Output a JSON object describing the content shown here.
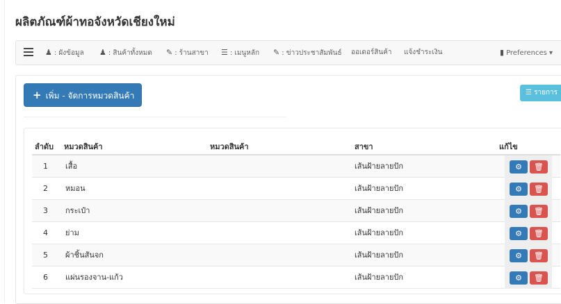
{
  "page": {
    "title": "ผลิตภัณฑ์ผ้าทอจังหวัดเชียงใหม่"
  },
  "nav": {
    "items": [
      {
        "icon": "user-icon",
        "glyph": "♟",
        "label": ": ผังข้อมูล"
      },
      {
        "icon": "user-icon",
        "glyph": "♟",
        "label": ": สินค้าทั้งหมด"
      },
      {
        "icon": "leaf-icon",
        "glyph": "✎",
        "label": ": ร้านสาขา"
      },
      {
        "icon": "list-icon",
        "glyph": "☰",
        "label": ": เมนูหลัก"
      },
      {
        "icon": "leaf-icon",
        "glyph": "✎",
        "label": ": ข่าวประชาสัมพันธ์"
      },
      {
        "icon": "",
        "glyph": "",
        "label": "ออเดอร์สินค้า"
      },
      {
        "icon": "",
        "glyph": "",
        "label": "แจ้งชำระเงิน"
      }
    ],
    "preferences": {
      "glyph": "▮",
      "label": "Preferences ▾"
    }
  },
  "actions": {
    "add_label": "เพิ่ม - จัดการหมวดสินค้า",
    "list_label": "☰ รายการ"
  },
  "table": {
    "headers": [
      "ลำดับ",
      "หมวดสินค้า",
      "หมวดสินค้า",
      "สาขา",
      "แก้ไข"
    ],
    "rows": [
      {
        "no": "1",
        "category": "เสื้อ",
        "branch": "เส้นฝ้ายลายปัก"
      },
      {
        "no": "2",
        "category": "หมอน",
        "branch": "เส้นฝ้ายลายปัก"
      },
      {
        "no": "3",
        "category": "กระเป๋า",
        "branch": "เส้นฝ้ายลายปัก"
      },
      {
        "no": "4",
        "category": "ย่าม",
        "branch": "เส้นฝ้ายลายปัก"
      },
      {
        "no": "5",
        "category": "ผ้าชิ้นสันจก",
        "branch": "เส้นฝ้ายลายปัก"
      },
      {
        "no": "6",
        "category": "แผ่นรองจาน-แก้ว",
        "branch": "เส้นฝ้ายลายปัก"
      }
    ],
    "edit_glyph": "⚙",
    "delete_glyph": "🗑"
  },
  "colors": {
    "primary": "#337ab7",
    "danger": "#d9534f",
    "info": "#5bc0de"
  }
}
